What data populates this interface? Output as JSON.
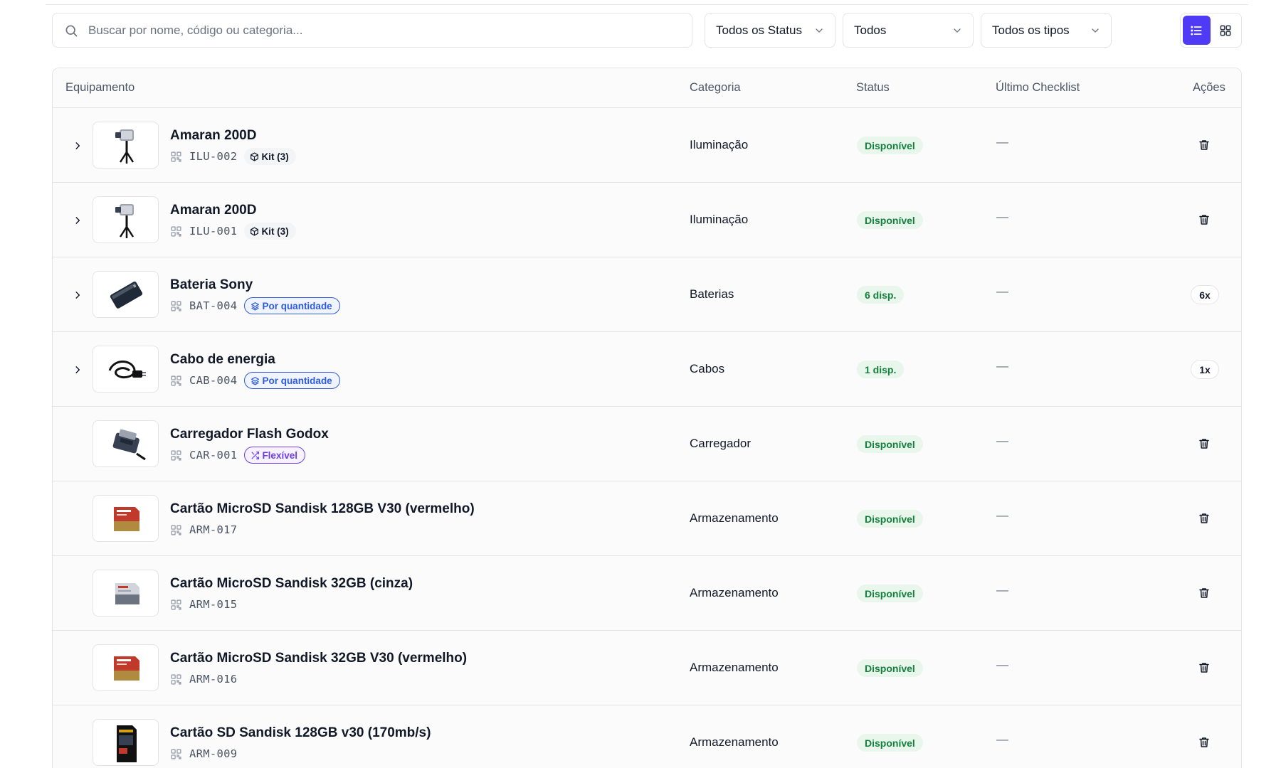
{
  "filters": {
    "search_placeholder": "Buscar por nome, código ou categoria...",
    "status_select": "Todos os Status",
    "second_select": "Todos",
    "type_select": "Todos os tipos",
    "view_mode": "list"
  },
  "table": {
    "headers": {
      "equipment": "Equipamento",
      "category": "Categoria",
      "status": "Status",
      "last_checklist": "Último Checklist",
      "actions": "Ações"
    },
    "rows": [
      {
        "name": "Amaran 200D",
        "code": "ILU-002",
        "tag": "Kit (3)",
        "category": "Iluminação",
        "status": "Disponível",
        "last_checklist": "—",
        "action": "trash-icon",
        "expandable": true
      },
      {
        "name": "Amaran 200D",
        "code": "ILU-001",
        "tag": "Kit (3)",
        "category": "Iluminação",
        "status": "Disponível",
        "last_checklist": "—",
        "action": "trash-icon",
        "expandable": true
      },
      {
        "name": "Bateria Sony",
        "code": "BAT-004",
        "tag": "Por quantidade",
        "category": "Baterias",
        "status": "6 disp.",
        "last_checklist": "—",
        "quantity": "6x",
        "expandable": true
      },
      {
        "name": "Cabo de energia",
        "code": "CAB-004",
        "tag": "Por quantidade",
        "category": "Cabos",
        "status": "1 disp.",
        "last_checklist": "—",
        "quantity": "1x",
        "expandable": true
      },
      {
        "name": "Carregador Flash Godox",
        "code": "CAR-001",
        "tag": "Flexível",
        "category": "Carregador",
        "status": "Disponível",
        "last_checklist": "—",
        "action": "trash-icon",
        "expandable": false
      },
      {
        "name": "Cartão MicroSD Sandisk 128GB V30 (vermelho)",
        "code": "ARM-017",
        "category": "Armazenamento",
        "status": "Disponível",
        "last_checklist": "—",
        "action": "trash-icon",
        "expandable": false
      },
      {
        "name": "Cartão MicroSD Sandisk 32GB (cinza)",
        "code": "ARM-015",
        "category": "Armazenamento",
        "status": "Disponível",
        "last_checklist": "—",
        "action": "trash-icon",
        "expandable": false
      },
      {
        "name": "Cartão MicroSD Sandisk 32GB V30 (vermelho)",
        "code": "ARM-016",
        "category": "Armazenamento",
        "status": "Disponível",
        "last_checklist": "—",
        "action": "trash-icon",
        "expandable": false
      },
      {
        "name": "Cartão SD Sandisk 128GB v30 (170mb/s)",
        "code": "ARM-009",
        "category": "Armazenamento",
        "status": "Disponível",
        "last_checklist": "—",
        "action": "trash-icon",
        "expandable": false
      }
    ]
  },
  "colors": {
    "accent": "#4f3bf5",
    "status_bg": "#e8f6ec",
    "status_text": "#15803d",
    "qty_tag": "#2f5bd8",
    "flex_tag": "#6d3ee8"
  }
}
